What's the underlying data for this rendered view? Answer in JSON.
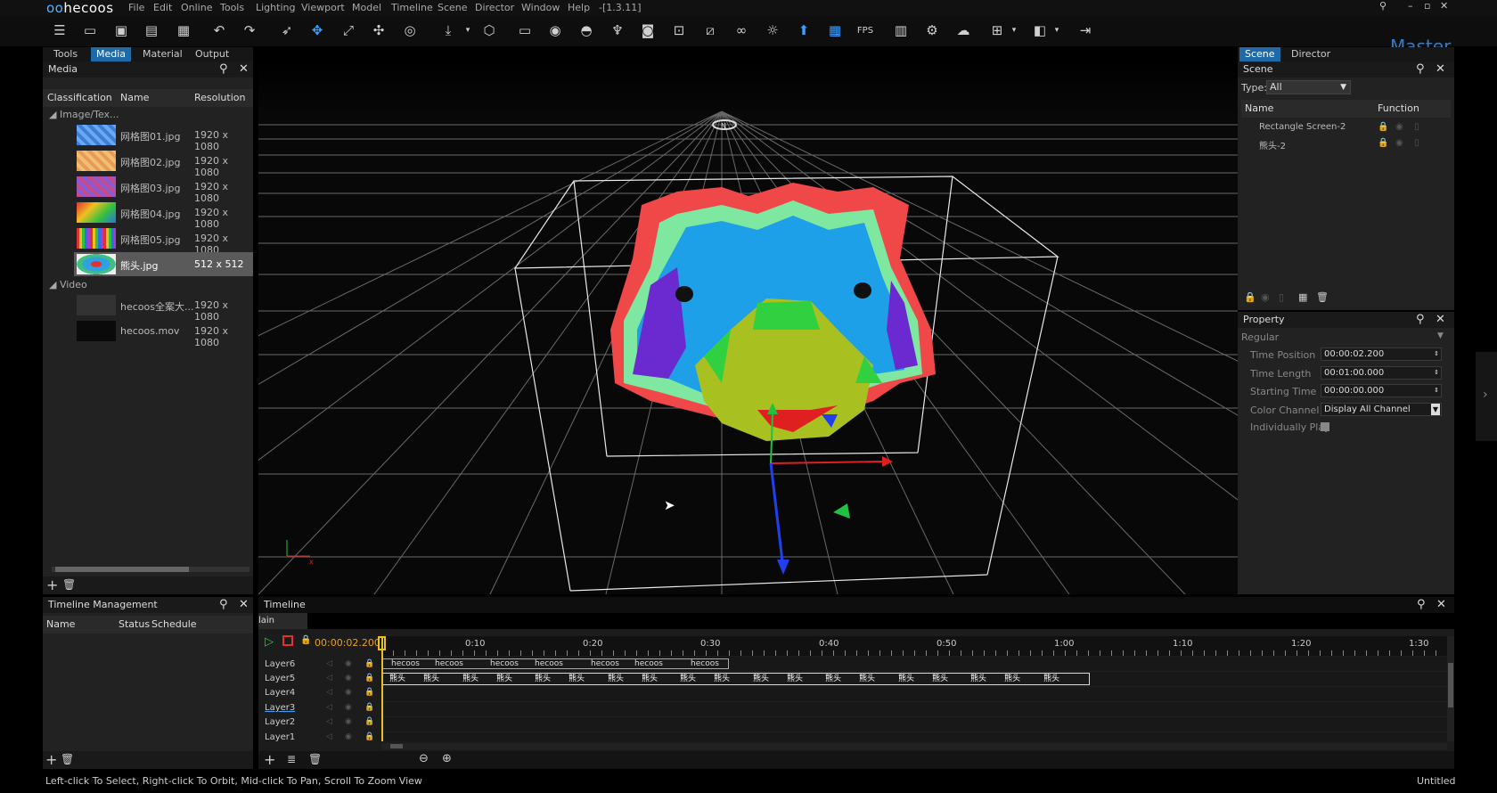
{
  "app": {
    "logo": "hecoos",
    "version": "-[1.3.11]",
    "mode_label": "Master"
  },
  "menu": [
    "File",
    "Edit",
    "Online",
    "Tools",
    "Lighting",
    "Viewport",
    "Model",
    "Timeline",
    "Scene",
    "Director",
    "Window",
    "Help"
  ],
  "left_tabs": [
    "Tools",
    "Media",
    "Material",
    "Output"
  ],
  "media": {
    "title": "Media",
    "columns": [
      "Classification",
      "Name",
      "Resolution"
    ],
    "group_image": "Image/Tex...",
    "group_video": "Video",
    "images": [
      {
        "name": "网格图01.jpg",
        "res": "1920 x 1080"
      },
      {
        "name": "网格图02.jpg",
        "res": "1920 x 1080"
      },
      {
        "name": "网格图03.jpg",
        "res": "1920 x 1080"
      },
      {
        "name": "网格图04.jpg",
        "res": "1920 x 1080"
      },
      {
        "name": "网格图05.jpg",
        "res": "1920 x 1080"
      },
      {
        "name": "熊头.jpg",
        "res": "512 x 512"
      }
    ],
    "videos": [
      {
        "name": "hecoos全案大...",
        "res": "1920 x 1080"
      },
      {
        "name": "hecoos.mov",
        "res": "1920 x 1080"
      }
    ]
  },
  "right_tabs": [
    "Scene",
    "Director"
  ],
  "scene": {
    "title": "Scene",
    "type_label": "Type:",
    "type_value": "All",
    "columns": [
      "Name",
      "Function"
    ],
    "items": [
      "Rectangle Screen-2",
      "熊头-2"
    ]
  },
  "property": {
    "title": "Property",
    "group": "Regular",
    "fields": [
      {
        "label": "Time Position",
        "value": "00:00:02.200"
      },
      {
        "label": "Time Length",
        "value": "00:01:00.000"
      },
      {
        "label": "Starting Time",
        "value": "00:00:00.000"
      },
      {
        "label": "Color Channel",
        "value": "Display All Channel"
      }
    ],
    "individually_play": "Individually Play"
  },
  "timeline_mgmt": {
    "title": "Timeline Management",
    "columns": [
      "Name",
      "Status",
      "Schedule"
    ]
  },
  "timeline": {
    "title": "Timeline",
    "main_tab": "lain Timelin",
    "current_time": "00:00:02.200",
    "ticks": [
      "0:10",
      "0:20",
      "0:30",
      "0:40",
      "0:50",
      "1:00",
      "1:10",
      "1:20",
      "1:30"
    ],
    "layers": [
      "Layer6",
      "Layer5",
      "Layer4",
      "Layer3",
      "Layer2",
      "Layer1"
    ],
    "clip_label_6": "hecoos",
    "clip_label_5": "熊头"
  },
  "viewport": {
    "compass": "N",
    "axis_x": "x"
  },
  "status_bar": {
    "hint": "Left-click To Select, Right-click To Orbit, Mid-click To Pan, Scroll To Zoom View",
    "doc": "Untitled"
  },
  "colors": {
    "accent": "#1e6aa8",
    "orange_time": "#e8a020",
    "play_green": "#2ecc40",
    "stop_red": "#e03030"
  }
}
